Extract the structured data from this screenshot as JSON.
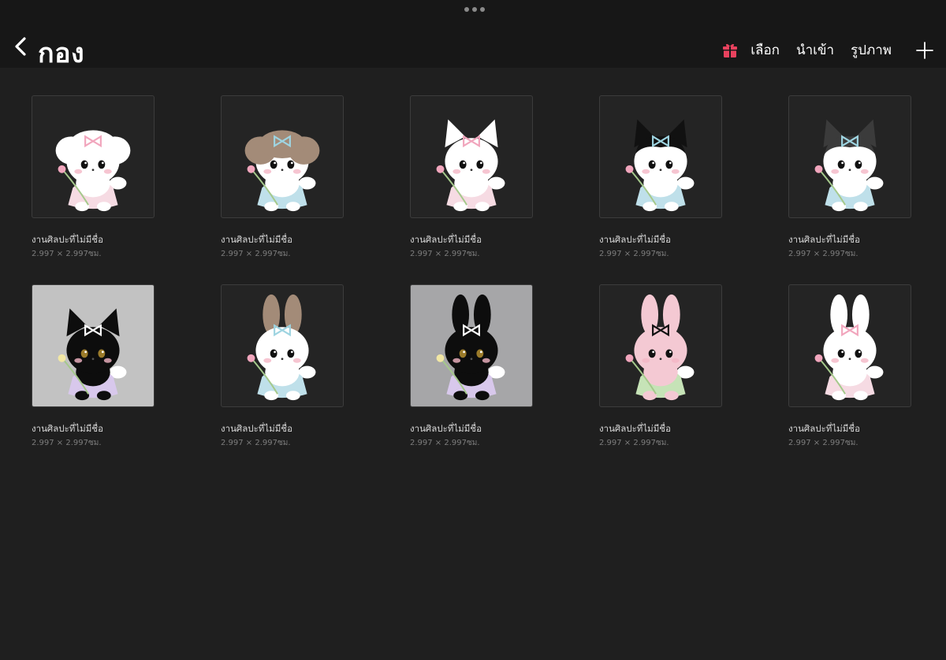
{
  "header": {
    "title": "กอง",
    "actions": {
      "select": "เลือก",
      "import": "นำเข้า",
      "photo": "รูปภาพ"
    },
    "gift_color": "#e8425e"
  },
  "artworks": [
    {
      "name": "งานศิลปะที่ไม่มีชื่อ",
      "size": "2.997 × 2.997ซม.",
      "bg": "#242424",
      "creature": "puppy",
      "fur": "#ffffff",
      "ear": "#ffffff",
      "dress": "#f6dbe3",
      "bow": "#f1a6bd",
      "flower": true
    },
    {
      "name": "งานศิลปะที่ไม่มีชื่อ",
      "size": "2.997 × 2.997ซม.",
      "bg": "#242424",
      "creature": "puppy",
      "fur": "#ffffff",
      "ear": "#a38b78",
      "dress": "#bfe0ea",
      "bow": "#9ed4e1",
      "flower": true
    },
    {
      "name": "งานศิลปะที่ไม่มีชื่อ",
      "size": "2.997 × 2.997ซม.",
      "bg": "#242424",
      "creature": "cat",
      "fur": "#ffffff",
      "ear": "#ffffff",
      "dress": "#f6dbe3",
      "bow": "#f1a6bd",
      "flower": true
    },
    {
      "name": "งานศิลปะที่ไม่มีชื่อ",
      "size": "2.997 × 2.997ซม.",
      "bg": "#242424",
      "creature": "cat",
      "fur": "#ffffff",
      "ear": "#111111",
      "dress": "#bfe0ea",
      "bow": "#9ed4e1",
      "flower": true
    },
    {
      "name": "งานศิลปะที่ไม่มีชื่อ",
      "size": "2.997 × 2.997ซม.",
      "bg": "#242424",
      "creature": "cat",
      "fur": "#ffffff",
      "ear": "#3b3b3b",
      "dress": "#bfe0ea",
      "bow": "#9ed4e1",
      "flower": true
    },
    {
      "name": "งานศิลปะที่ไม่มีชื่อ",
      "size": "2.997 × 2.997ซม.",
      "bg": "#c2c2c2",
      "creature": "cat",
      "fur": "#0d0d0d",
      "ear": "#0d0d0d",
      "dress": "#d8c8ec",
      "bow": "#ffffff",
      "flower": true
    },
    {
      "name": "งานศิลปะที่ไม่มีชื่อ",
      "size": "2.997 × 2.997ซม.",
      "bg": "#242424",
      "creature": "bunny",
      "fur": "#ffffff",
      "ear": "#a38b78",
      "dress": "#bfe0ea",
      "bow": "#9ed4e1",
      "flower": true
    },
    {
      "name": "งานศิลปะที่ไม่มีชื่อ",
      "size": "2.997 × 2.997ซม.",
      "bg": "#a6a6a8",
      "creature": "bunny",
      "fur": "#0d0d0d",
      "ear": "#0d0d0d",
      "dress": "#d8c8ec",
      "bow": "#ffffff",
      "flower": true
    },
    {
      "name": "งานศิลปะที่ไม่มีชื่อ",
      "size": "2.997 × 2.997ซม.",
      "bg": "#242424",
      "creature": "bunny",
      "fur": "#f4c9d3",
      "ear": "#f4c9d3",
      "dress": "#c6e3b7",
      "bow": "#111111",
      "flower": true
    },
    {
      "name": "งานศิลปะที่ไม่มีชื่อ",
      "size": "2.997 × 2.997ซม.",
      "bg": "#242424",
      "creature": "bunny",
      "fur": "#ffffff",
      "ear": "#ffffff",
      "dress": "#f6dbe3",
      "bow": "#f1a6bd",
      "flower": true
    }
  ]
}
